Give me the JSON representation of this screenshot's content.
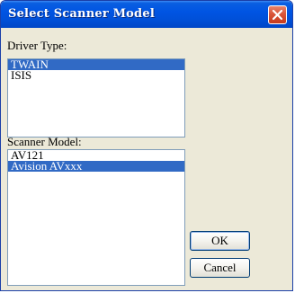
{
  "window": {
    "title": "Select Scanner Model"
  },
  "driver_type": {
    "label": "Driver Type:",
    "items": [
      {
        "label": "TWAIN",
        "selected": true
      },
      {
        "label": "ISIS",
        "selected": false
      }
    ]
  },
  "scanner_model": {
    "label": "Scanner Model:",
    "items": [
      {
        "label": "AV121",
        "selected": false
      },
      {
        "label": "Avision AVxxx",
        "selected": true
      }
    ]
  },
  "buttons": {
    "ok_label": "OK",
    "cancel_label": "Cancel"
  },
  "colors": {
    "titlebar": "#0054e3",
    "selection": "#316ac5",
    "close_button": "#d9553a",
    "dialog_background": "#ece9d8"
  },
  "icons": {
    "close": "close-icon"
  }
}
